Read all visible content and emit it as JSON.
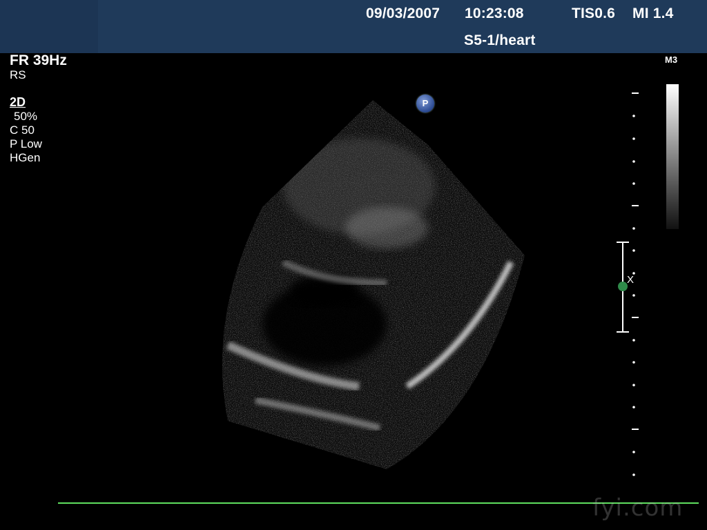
{
  "header": {
    "date": "09/03/2007",
    "time": "10:23:08",
    "tis": "TIS0.6",
    "mi": "MI 1.4",
    "probe_preset": "S5-1/heart"
  },
  "parameters": {
    "frame_rate": "FR 39Hz",
    "rs": "RS",
    "mode": "2D",
    "gain": "50%",
    "compression": "C 50",
    "power": "P Low",
    "frequency": "HGen"
  },
  "map": {
    "label": "M3"
  },
  "orientation_marker": {
    "label": "P"
  },
  "focus": {
    "label": "X"
  },
  "watermark": {
    "text": "fyi.com"
  },
  "colors": {
    "header_bg": "#1f3a5a",
    "baseline": "#5fe05f",
    "focus_dot": "#2f8a4a"
  }
}
